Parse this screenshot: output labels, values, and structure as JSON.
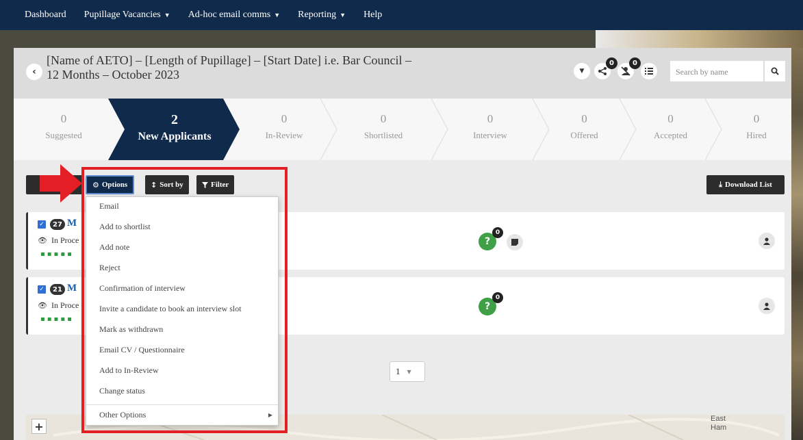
{
  "nav": {
    "items": [
      {
        "label": "Dashboard",
        "caret": false
      },
      {
        "label": "Pupillage Vacancies",
        "caret": true
      },
      {
        "label": "Ad-hoc email comms",
        "caret": true
      },
      {
        "label": "Reporting",
        "caret": true
      },
      {
        "label": "Help",
        "caret": false
      }
    ]
  },
  "header": {
    "title": "[Name of AETO] – [Length of Pupillage] – [Start Date] i.e. Bar Council – 12 Months – October 2023",
    "share_count": "0",
    "reject_count": "0",
    "search_placeholder": "Search by name"
  },
  "pipeline": {
    "stages": [
      {
        "count": "0",
        "label": "Suggested",
        "active": false
      },
      {
        "count": "2",
        "label": "New Applicants",
        "active": true
      },
      {
        "count": "0",
        "label": "In-Review",
        "active": false
      },
      {
        "count": "0",
        "label": "Shortlisted",
        "active": false
      },
      {
        "count": "0",
        "label": "Interview",
        "active": false
      },
      {
        "count": "0",
        "label": "Offered",
        "active": false
      },
      {
        "count": "0",
        "label": "Accepted",
        "active": false
      },
      {
        "count": "0",
        "label": "Hired",
        "active": false
      }
    ],
    "active_color": "#0f2a4b"
  },
  "toolbar": {
    "options_label": "Options",
    "sort_label": "Sort by",
    "filter_label": "Filter",
    "download_label": "Download List"
  },
  "applicants": [
    {
      "num": "27",
      "name": "M",
      "status": "In Proce",
      "question_count": "0"
    },
    {
      "num": "21",
      "name": "M",
      "status": "In Proce",
      "question_count": "0"
    }
  ],
  "pager": {
    "page": "1"
  },
  "dropdown": {
    "items": [
      "Email",
      "Add to shortlist",
      "Add note",
      "Reject",
      "Confirmation of interview",
      "Invite a candidate to book an interview slot",
      "Mark as withdrawn",
      "Email CV / Questionnaire",
      "Add to In-Review",
      "Change status"
    ],
    "other_options": "Other Options"
  },
  "map": {
    "label_line1": "East",
    "label_line2": "Ham"
  },
  "colors": {
    "nav": "#0f2a4b",
    "highlight": "#e31e24",
    "green": "#3fa048"
  }
}
